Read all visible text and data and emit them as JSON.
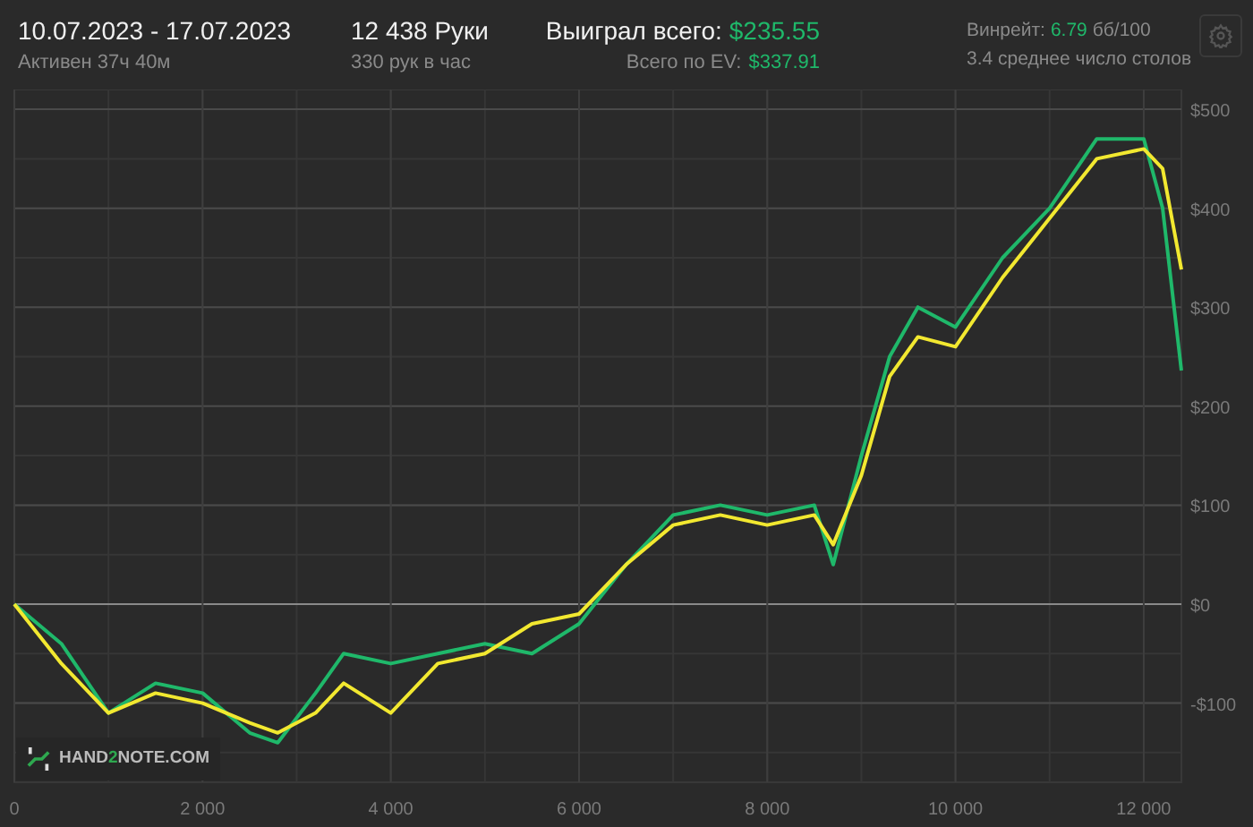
{
  "header": {
    "date_range": "10.07.2023 - 17.07.2023",
    "active_time": "Активен 37ч 40м",
    "hands": "12 438 Руки",
    "hands_per_hour": "330 рук в час",
    "won_label": "Выиграл всего:",
    "won_value": "$235.55",
    "ev_label": "Всего по EV:",
    "ev_value": "$337.91",
    "winrate_label": "Винрейт:",
    "winrate_value": "6.79",
    "winrate_unit": "бб/100",
    "avg_tables": "3.4 среднее число столов"
  },
  "watermark": {
    "brand_a": "HAND",
    "brand_b": "2",
    "brand_c": "NOTE.COM"
  },
  "chart_data": {
    "type": "line",
    "x": [
      0,
      500,
      1000,
      1500,
      2000,
      2500,
      2800,
      3200,
      3500,
      4000,
      4500,
      5000,
      5500,
      6000,
      6500,
      7000,
      7500,
      8000,
      8500,
      8700,
      9000,
      9300,
      9600,
      10000,
      10500,
      11000,
      11500,
      12000,
      12200,
      12400
    ],
    "series": [
      {
        "color": "#1fb86a",
        "values": [
          0,
          -40,
          -110,
          -80,
          -90,
          -130,
          -140,
          -90,
          -50,
          -60,
          -50,
          -40,
          -50,
          -20,
          40,
          90,
          100,
          90,
          100,
          40,
          150,
          250,
          300,
          280,
          350,
          400,
          470,
          470,
          400,
          236
        ]
      },
      {
        "color": "#f2e830",
        "values": [
          0,
          -60,
          -110,
          -90,
          -100,
          -120,
          -130,
          -110,
          -80,
          -110,
          -60,
          -50,
          -20,
          -10,
          40,
          80,
          90,
          80,
          90,
          60,
          130,
          230,
          270,
          260,
          330,
          390,
          450,
          460,
          440,
          338
        ]
      }
    ],
    "grid": true,
    "xlim": [
      0,
      12400
    ],
    "ylim": [
      -180,
      520
    ],
    "xticks": [
      {
        "value": 0,
        "label": "0"
      },
      {
        "value": 2000,
        "label": "2 000"
      },
      {
        "value": 4000,
        "label": "4 000"
      },
      {
        "value": 6000,
        "label": "6 000"
      },
      {
        "value": 8000,
        "label": "8 000"
      },
      {
        "value": 10000,
        "label": "10 000"
      },
      {
        "value": 12000,
        "label": "12 000"
      }
    ],
    "yticks": [
      {
        "value": -100,
        "label": "-$100"
      },
      {
        "value": 0,
        "label": "$0"
      },
      {
        "value": 100,
        "label": "$100"
      },
      {
        "value": 200,
        "label": "$200"
      },
      {
        "value": 300,
        "label": "$300"
      },
      {
        "value": 400,
        "label": "$400"
      },
      {
        "value": 500,
        "label": "$500"
      }
    ]
  }
}
